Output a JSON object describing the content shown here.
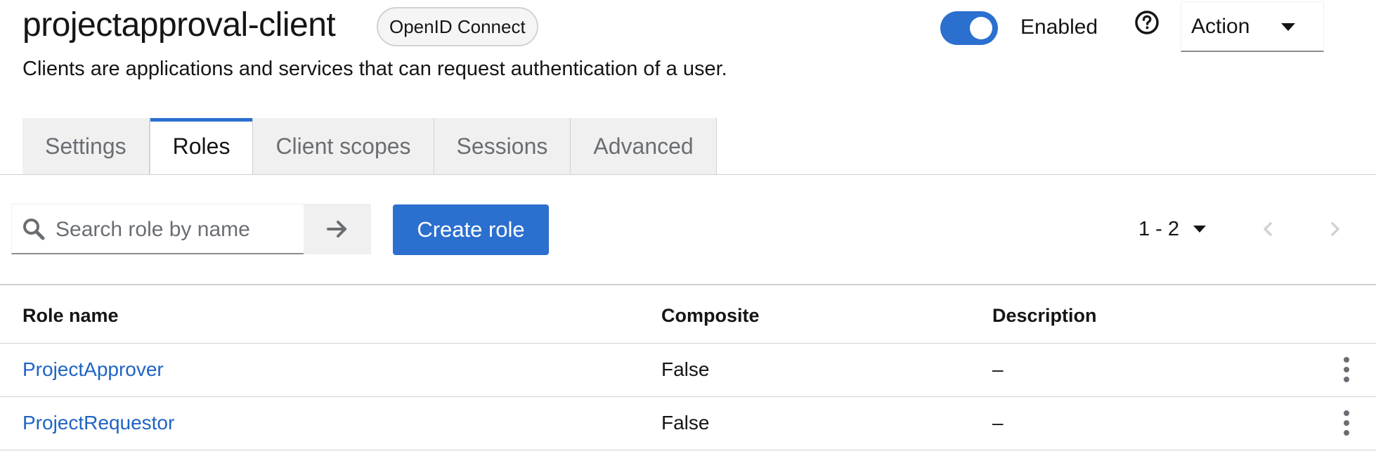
{
  "header": {
    "title": "projectapproval-client",
    "protocol_badge": "OpenID Connect",
    "subtitle": "Clients are applications and services that can request authentication of a user.",
    "enabled_label": "Enabled",
    "enabled": true,
    "action_label": "Action"
  },
  "tabs": [
    {
      "label": "Settings",
      "active": false
    },
    {
      "label": "Roles",
      "active": true
    },
    {
      "label": "Client scopes",
      "active": false
    },
    {
      "label": "Sessions",
      "active": false
    },
    {
      "label": "Advanced",
      "active": false
    }
  ],
  "toolbar": {
    "search_placeholder": "Search role by name",
    "search_value": "",
    "create_label": "Create role",
    "pagination_range": "1 - 2"
  },
  "table": {
    "columns": [
      "Role name",
      "Composite",
      "Description"
    ],
    "rows": [
      {
        "name": "ProjectApprover",
        "composite": "False",
        "description": "–"
      },
      {
        "name": "ProjectRequestor",
        "composite": "False",
        "description": "–"
      }
    ]
  },
  "colors": {
    "primary": "#2b6fcf",
    "link": "#1f64c4",
    "border": "#d2d2d2",
    "tab_bg": "#f0f0f0"
  }
}
